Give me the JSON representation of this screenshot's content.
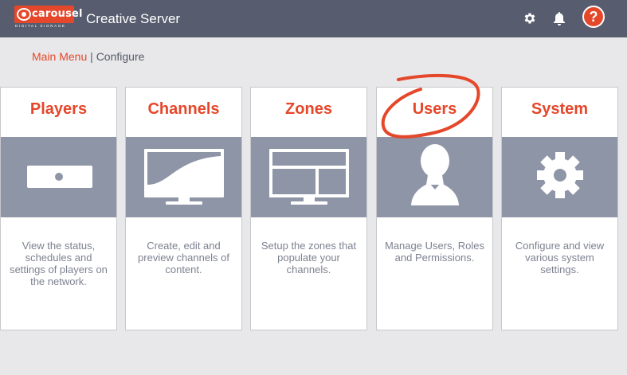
{
  "header": {
    "logo_word": "carousel",
    "logo_subtext": "DIGITAL SIGNAGE",
    "app_title": "Creative Server",
    "help_label": "?"
  },
  "breadcrumb": {
    "root": "Main Menu",
    "separator": "|",
    "current": "Configure"
  },
  "cards": [
    {
      "title": "Players",
      "description": "View the status, schedules and settings of players on the network.",
      "icon": "player-device-icon"
    },
    {
      "title": "Channels",
      "description": "Create, edit and preview channels of content.",
      "icon": "monitor-icon"
    },
    {
      "title": "Zones",
      "description": "Setup the zones that populate your channels.",
      "icon": "zones-layout-icon"
    },
    {
      "title": "Users",
      "description": "Manage Users, Roles and Permissions.",
      "icon": "user-silhouette-icon"
    },
    {
      "title": "System",
      "description": "Configure and view various system settings.",
      "icon": "gear-icon"
    }
  ],
  "colors": {
    "accent": "#e5472a",
    "header_bg": "#575d6e",
    "band_bg": "#8e95a6",
    "page_bg": "#e8e8ea"
  }
}
